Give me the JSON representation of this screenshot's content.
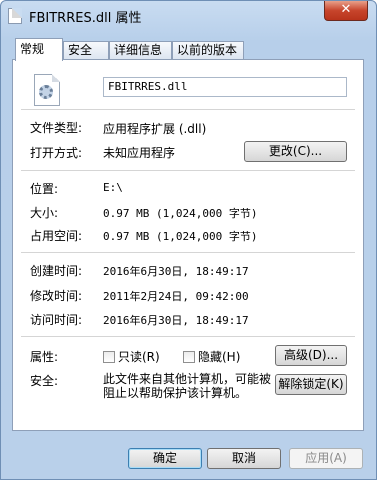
{
  "window": {
    "title": "FBITRRES.dll 属性",
    "close_glyph": "✕"
  },
  "tabs": [
    {
      "label": "常规",
      "active": true
    },
    {
      "label": "安全",
      "active": false
    },
    {
      "label": "详细信息",
      "active": false
    },
    {
      "label": "以前的版本",
      "active": false
    }
  ],
  "general": {
    "file_name": "FBITRRES.dll",
    "file_type_label": "文件类型:",
    "file_type_value": "应用程序扩展 (.dll)",
    "open_with_label": "打开方式:",
    "open_with_value": "未知应用程序",
    "change_button": "更改(C)...",
    "location_label": "位置:",
    "location_value": "E:\\",
    "size_label": "大小:",
    "size_value": "0.97 MB (1,024,000 字节)",
    "size_on_disk_label": "占用空间:",
    "size_on_disk_value": "0.97 MB (1,024,000 字节)",
    "created_label": "创建时间:",
    "created_value": "2016年6月30日, 18:49:17",
    "modified_label": "修改时间:",
    "modified_value": "2011年2月24日, 09:42:00",
    "accessed_label": "访问时间:",
    "accessed_value": "2016年6月30日, 18:49:17",
    "attributes_label": "属性:",
    "readonly_label": "只读(R)",
    "hidden_label": "隐藏(H)",
    "advanced_button": "高级(D)...",
    "security_label": "安全:",
    "security_text": "此文件来自其他计算机，可能被阻止以帮助保护该计算机。",
    "unblock_button": "解除锁定(K)"
  },
  "footer": {
    "ok": "确定",
    "cancel": "取消",
    "apply": "应用(A)"
  }
}
